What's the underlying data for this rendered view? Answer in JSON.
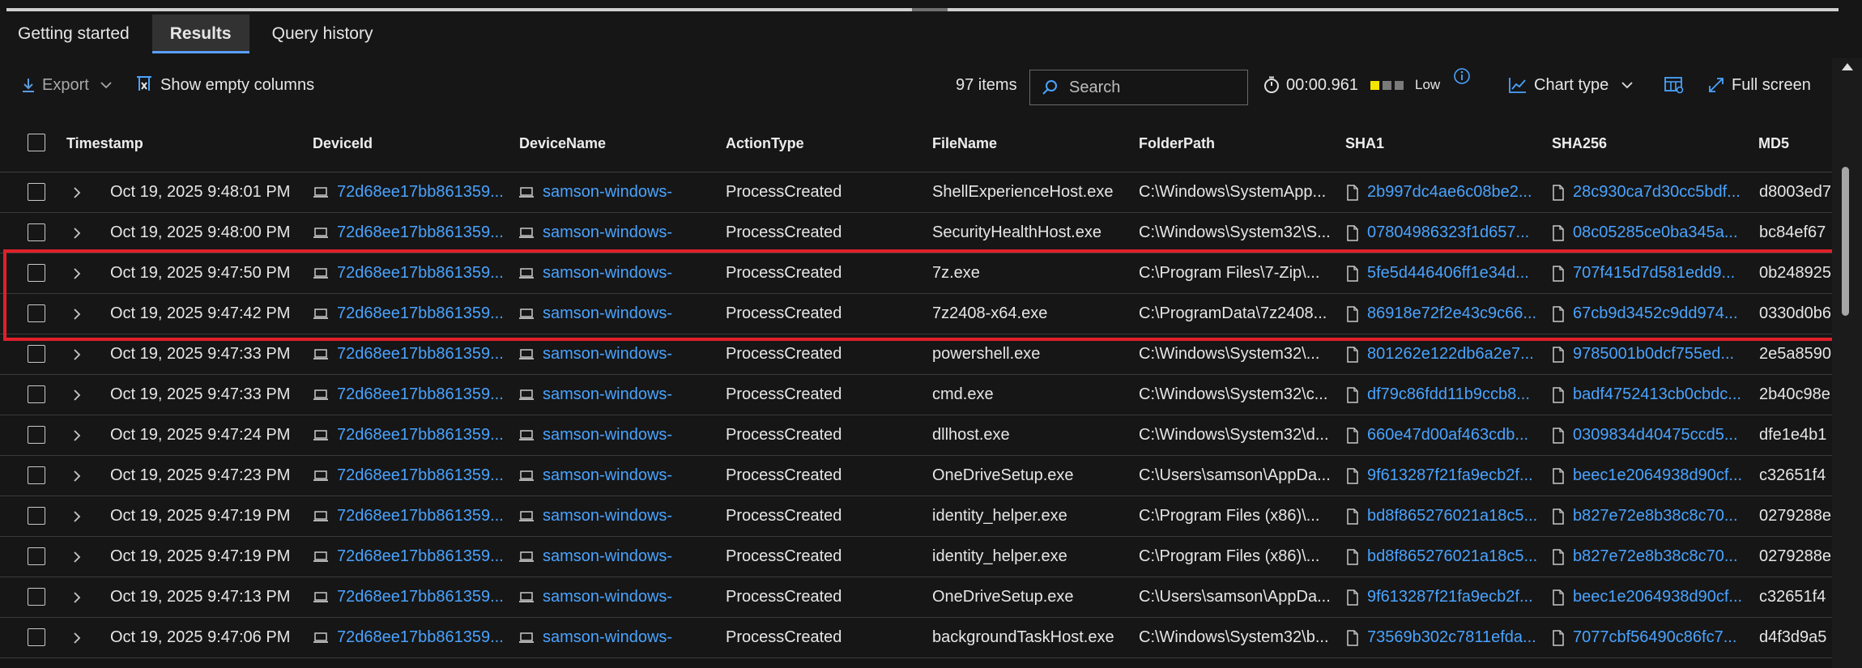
{
  "tabs": [
    {
      "label": "Getting started"
    },
    {
      "label": "Results"
    },
    {
      "label": "Query history"
    }
  ],
  "toolbar": {
    "export_label": "Export",
    "show_empty_label": "Show empty columns",
    "items_count": "97 items",
    "search_placeholder": "Search",
    "elapsed": "00:00.961",
    "resource_level": "Low",
    "chart_type_label": "Chart type",
    "full_screen_label": "Full screen"
  },
  "colors": {
    "link": "#4aa3ff",
    "tab_underline": "#5aa0ff",
    "highlight_box": "#e0202a",
    "load_indicator": "#f5e400"
  },
  "columns": [
    "Timestamp",
    "DeviceId",
    "DeviceName",
    "ActionType",
    "FileName",
    "FolderPath",
    "SHA1",
    "SHA256",
    "MD5"
  ],
  "rows": [
    {
      "timestamp": "Oct 19, 2025 9:48:01 PM",
      "device_id": "72d68ee17bb861359...",
      "device_name": "samson-windows-",
      "action_type": "ProcessCreated",
      "file_name": "ShellExperienceHost.exe",
      "folder_path": "C:\\Windows\\SystemApp...",
      "sha1": "2b997dc4ae6c08be2...",
      "sha256": "28c930ca7d30cc5bdf...",
      "md5": "d8003ed7"
    },
    {
      "timestamp": "Oct 19, 2025 9:48:00 PM",
      "device_id": "72d68ee17bb861359...",
      "device_name": "samson-windows-",
      "action_type": "ProcessCreated",
      "file_name": "SecurityHealthHost.exe",
      "folder_path": "C:\\Windows\\System32\\S...",
      "sha1": "07804986323f1d657...",
      "sha256": "08c05285ce0ba345a...",
      "md5": "bc84ef67"
    },
    {
      "timestamp": "Oct 19, 2025 9:47:50 PM",
      "device_id": "72d68ee17bb861359...",
      "device_name": "samson-windows-",
      "action_type": "ProcessCreated",
      "file_name": "7z.exe",
      "folder_path": "C:\\Program Files\\7-Zip\\...",
      "sha1": "5fe5d446406ff1e34d...",
      "sha256": "707f415d7d581edd9...",
      "md5": "0b248925"
    },
    {
      "timestamp": "Oct 19, 2025 9:47:42 PM",
      "device_id": "72d68ee17bb861359...",
      "device_name": "samson-windows-",
      "action_type": "ProcessCreated",
      "file_name": "7z2408-x64.exe",
      "folder_path": "C:\\ProgramData\\7z2408...",
      "sha1": "86918e72f2e43c9c66...",
      "sha256": "67cb9d3452c9dd974...",
      "md5": "0330d0b6"
    },
    {
      "timestamp": "Oct 19, 2025 9:47:33 PM",
      "device_id": "72d68ee17bb861359...",
      "device_name": "samson-windows-",
      "action_type": "ProcessCreated",
      "file_name": "powershell.exe",
      "folder_path": "C:\\Windows\\System32\\...",
      "sha1": "801262e122db6a2e7...",
      "sha256": "9785001b0dcf755ed...",
      "md5": "2e5a8590"
    },
    {
      "timestamp": "Oct 19, 2025 9:47:33 PM",
      "device_id": "72d68ee17bb861359...",
      "device_name": "samson-windows-",
      "action_type": "ProcessCreated",
      "file_name": "cmd.exe",
      "folder_path": "C:\\Windows\\System32\\c...",
      "sha1": "df79c86fdd11b9ccb8...",
      "sha256": "badf4752413cb0cbdc...",
      "md5": "2b40c98e"
    },
    {
      "timestamp": "Oct 19, 2025 9:47:24 PM",
      "device_id": "72d68ee17bb861359...",
      "device_name": "samson-windows-",
      "action_type": "ProcessCreated",
      "file_name": "dllhost.exe",
      "folder_path": "C:\\Windows\\System32\\d...",
      "sha1": "660e47d00af463cdb...",
      "sha256": "0309834d40475ccd5...",
      "md5": "dfe1e4b1"
    },
    {
      "timestamp": "Oct 19, 2025 9:47:23 PM",
      "device_id": "72d68ee17bb861359...",
      "device_name": "samson-windows-",
      "action_type": "ProcessCreated",
      "file_name": "OneDriveSetup.exe",
      "folder_path": "C:\\Users\\samson\\AppDa...",
      "sha1": "9f613287f21fa9ecb2f...",
      "sha256": "beec1e2064938d90cf...",
      "md5": "c32651f4"
    },
    {
      "timestamp": "Oct 19, 2025 9:47:19 PM",
      "device_id": "72d68ee17bb861359...",
      "device_name": "samson-windows-",
      "action_type": "ProcessCreated",
      "file_name": "identity_helper.exe",
      "folder_path": "C:\\Program Files (x86)\\...",
      "sha1": "bd8f865276021a18c5...",
      "sha256": "b827e72e8b38c8c70...",
      "md5": "0279288e"
    },
    {
      "timestamp": "Oct 19, 2025 9:47:19 PM",
      "device_id": "72d68ee17bb861359...",
      "device_name": "samson-windows-",
      "action_type": "ProcessCreated",
      "file_name": "identity_helper.exe",
      "folder_path": "C:\\Program Files (x86)\\...",
      "sha1": "bd8f865276021a18c5...",
      "sha256": "b827e72e8b38c8c70...",
      "md5": "0279288e"
    },
    {
      "timestamp": "Oct 19, 2025 9:47:13 PM",
      "device_id": "72d68ee17bb861359...",
      "device_name": "samson-windows-",
      "action_type": "ProcessCreated",
      "file_name": "OneDriveSetup.exe",
      "folder_path": "C:\\Users\\samson\\AppDa...",
      "sha1": "9f613287f21fa9ecb2f...",
      "sha256": "beec1e2064938d90cf...",
      "md5": "c32651f4"
    },
    {
      "timestamp": "Oct 19, 2025 9:47:06 PM",
      "device_id": "72d68ee17bb861359...",
      "device_name": "samson-windows-",
      "action_type": "ProcessCreated",
      "file_name": "backgroundTaskHost.exe",
      "folder_path": "C:\\Windows\\System32\\b...",
      "sha1": "73569b302c7811efda...",
      "sha256": "7077cbf56490c86fc7...",
      "md5": "d4f3d9a5"
    }
  ]
}
